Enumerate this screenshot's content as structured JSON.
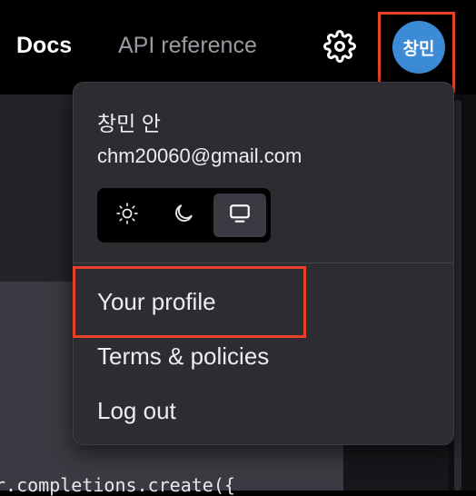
{
  "header": {
    "docs_label": "Docs",
    "api_reference_label": "API reference",
    "settings_icon": "gear-icon",
    "avatar_initials": "창민",
    "avatar_color": "#3b8bd6"
  },
  "account_menu": {
    "user_name": "창민 안",
    "user_email": "chm20060@gmail.com",
    "theme_options": [
      {
        "icon": "sun-icon",
        "label": "Light"
      },
      {
        "icon": "moon-icon",
        "label": "Dark"
      },
      {
        "icon": "monitor-icon",
        "label": "System",
        "selected": true
      }
    ],
    "items": [
      {
        "label": "Your profile"
      },
      {
        "label": "Terms & policies"
      },
      {
        "label": "Log out"
      }
    ]
  },
  "background_code": {
    "line": "r.completions.create({"
  },
  "highlight_color": "#e8412a"
}
